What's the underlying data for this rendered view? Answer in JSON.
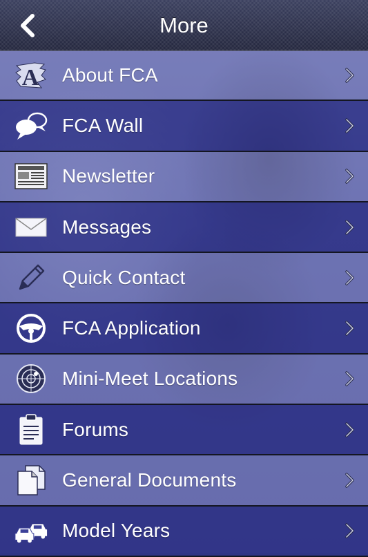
{
  "header": {
    "title": "More",
    "back_icon": "chevron-left-icon"
  },
  "menu": [
    {
      "label": "About FCA",
      "icon": "fca-logo-icon"
    },
    {
      "label": "FCA Wall",
      "icon": "speech-bubbles-icon"
    },
    {
      "label": "Newsletter",
      "icon": "newspaper-icon"
    },
    {
      "label": "Messages",
      "icon": "envelope-icon"
    },
    {
      "label": "Quick Contact",
      "icon": "pencil-icon"
    },
    {
      "label": "FCA Application",
      "icon": "steering-wheel-icon"
    },
    {
      "label": "Mini-Meet Locations",
      "icon": "radar-icon"
    },
    {
      "label": "Forums",
      "icon": "clipboard-icon"
    },
    {
      "label": "General Documents",
      "icon": "documents-icon"
    },
    {
      "label": "Model Years",
      "icon": "cars-icon"
    }
  ],
  "colors": {
    "header": "#23263d",
    "row_light": "#8a8fc8",
    "row_dark": "#3c4199",
    "text": "#ffffff"
  }
}
